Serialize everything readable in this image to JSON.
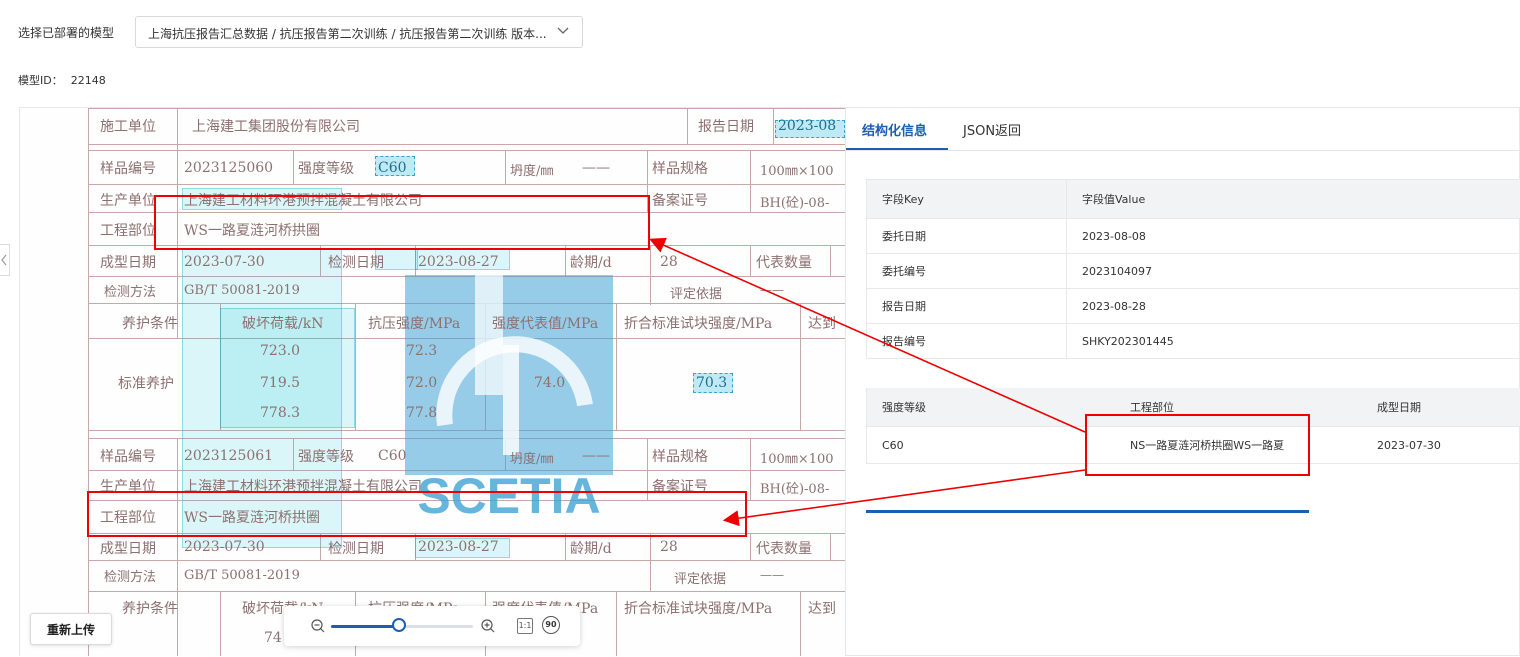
{
  "header": {
    "model_label": "选择已部署的模型",
    "model_value": "上海抗压报告汇总数据 / 抗压报告第二次训练 / 抗压报告第二次训练 版本...",
    "model_id_label": "模型ID：",
    "model_id": "22148"
  },
  "document": {
    "r1": {
      "label": "施工单位",
      "value": "上海建工集团股份有限公司",
      "date_label": "报告日期",
      "date_value": "2023-08"
    },
    "r2": {
      "label": "样品编号",
      "sample_no": "2023125060",
      "grade_label": "强度等级",
      "grade": "C60",
      "slump_label": "坍度/㎜",
      "slump": "——",
      "spec_label": "样品规格",
      "spec": "100㎜×100"
    },
    "r3": {
      "label": "生产单位",
      "value": "上海建工材料环港预拌混凝土有限公司",
      "record_label": "备案证号",
      "record": "BH(砼)-08-"
    },
    "r4": {
      "label": "工程部位",
      "value": "WS一路夏涟河桥拱圈"
    },
    "r5": {
      "label": "成型日期",
      "value": "2023-07-30",
      "test_label": "检测日期",
      "test_value": "2023-08-27",
      "age_label": "龄期/d",
      "age": "28",
      "rep_label": "代表数量"
    },
    "r6": {
      "label": "检测方法",
      "value": "GB/T 50081-2019",
      "eval_label": "评定依据",
      "eval": "——"
    },
    "r7": {
      "c1": "养护条件",
      "c2": "破坏荷载/kN",
      "c3": "抗压强度/MPa",
      "c4": "强度代表值/MPa",
      "c5": "折合标准试块强度/MPa",
      "c6": "达到"
    },
    "r8": {
      "cure": "标准养护",
      "loads": [
        "723.0",
        "719.5",
        "778.3"
      ],
      "strengths": [
        "72.3",
        "72.0",
        "77.8"
      ],
      "rep": "74.0",
      "std": "70.3"
    },
    "r9": {
      "label": "样品编号",
      "sample_no": "2023125061",
      "grade_label": "强度等级",
      "grade": "C60",
      "slump_label": "坍度/㎜",
      "slump": "——",
      "spec_label": "样品规格",
      "spec": "100㎜×100"
    },
    "r10": {
      "label": "生产单位",
      "value": "上海建工材料环港预拌混凝土有限公司",
      "record_label": "备案证号",
      "record": "BH(砼)-08-"
    },
    "r11": {
      "label": "工程部位",
      "value": "WS一路夏涟河桥拱圈"
    },
    "r12": {
      "label": "成型日期",
      "value": "2023-07-30",
      "test_label": "检测日期",
      "test_value": "2023-08-27",
      "age_label": "龄期/d",
      "age": "28",
      "rep_label": "代表数量"
    },
    "r13": {
      "label": "检测方法",
      "value": "GB/T 50081-2019",
      "eval_label": "评定依据",
      "eval": "——"
    },
    "r14": {
      "c1": "养护条件",
      "c2": "破坏荷载/kN",
      "c3": "抗压强度/MPa",
      "c4": "强度代表值/MPa",
      "c5": "折合标准试块强度/MPa",
      "c6": "达到"
    },
    "r15_load": "74",
    "watermark_text": "SCETIA"
  },
  "tabs": [
    {
      "label": "结构化信息"
    },
    {
      "label": "JSON返回"
    }
  ],
  "kv_table": {
    "headers": [
      "字段Key",
      "字段值Value"
    ],
    "rows": [
      [
        "委托日期",
        "2023-08-08"
      ],
      [
        "委托编号",
        "2023104097"
      ],
      [
        "报告日期",
        "2023-08-28"
      ],
      [
        "报告编号",
        "SHKY202301445"
      ]
    ]
  },
  "detail_table": {
    "headers": [
      "强度等级",
      "工程部位",
      "成型日期"
    ],
    "rows": [
      [
        "C60",
        "NS一路夏涟河桥拱圈WS一路夏",
        "2023-07-30"
      ]
    ]
  },
  "toolbar": {
    "reupload": "重新上传",
    "zoom_level": 0.48,
    "actual_size": "1:1",
    "rotate": "90"
  }
}
